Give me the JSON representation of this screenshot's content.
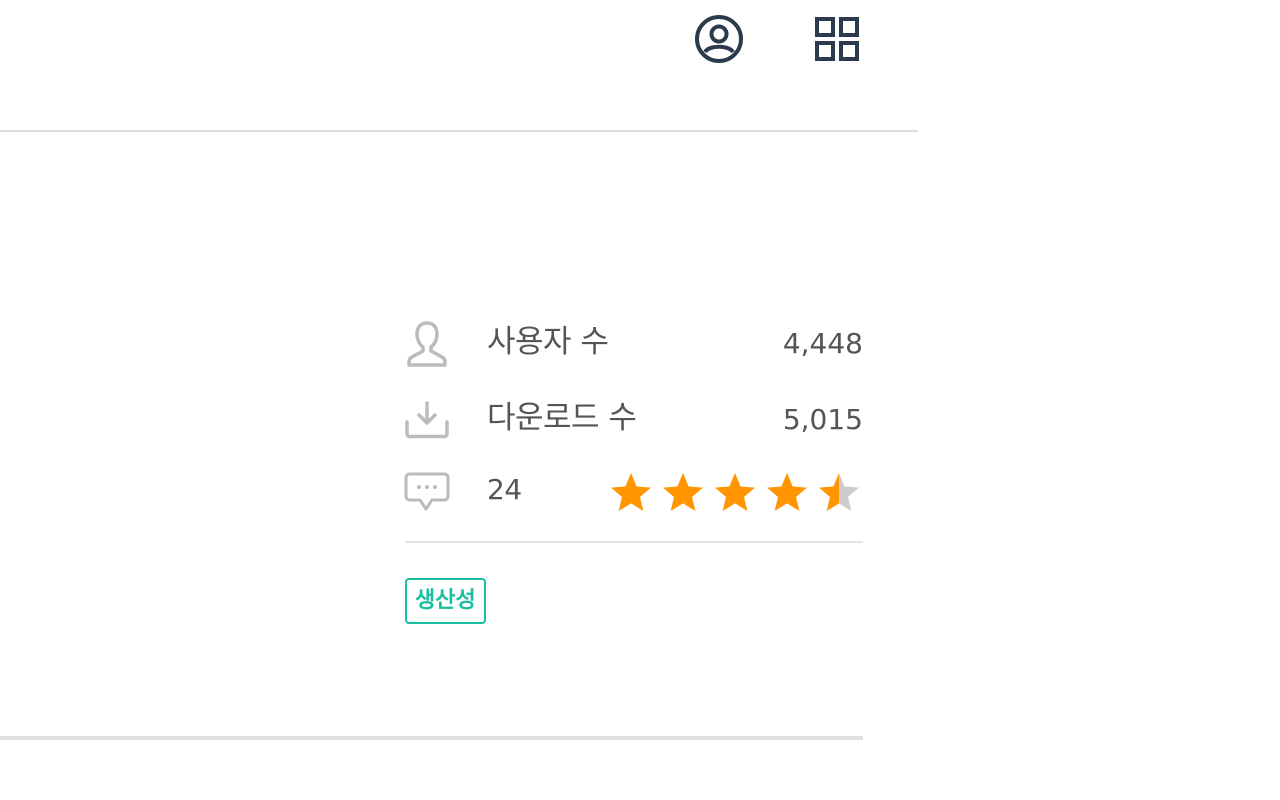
{
  "header": {
    "account_icon": "account-circle-icon",
    "apps_icon": "apps-grid-icon",
    "icon_color": "#2c3a4d"
  },
  "stats": {
    "users": {
      "icon": "user-icon",
      "label": "사용자 수",
      "value": "4,448"
    },
    "downloads": {
      "icon": "download-icon",
      "label": "다운로드 수",
      "value": "5,015"
    },
    "reviews": {
      "icon": "comment-icon",
      "count": "24",
      "rating": 4.5,
      "max_rating": 5
    }
  },
  "tags": [
    {
      "label": "생산성"
    }
  ],
  "colors": {
    "star_filled": "#ff9500",
    "star_empty": "#cccccc",
    "tag_accent": "#19bfa0",
    "text": "#555555",
    "icon_gray": "#bbbbbb"
  }
}
